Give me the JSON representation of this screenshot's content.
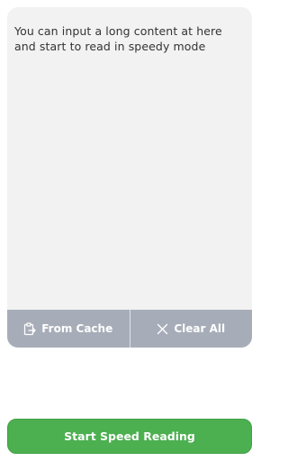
{
  "editor": {
    "placeholder": "You can input a long content at here and start to read in speedy mode"
  },
  "actions": {
    "from_cache_label": "From Cache",
    "clear_all_label": "Clear All"
  },
  "start_button": {
    "label": "Start Speed Reading"
  },
  "colors": {
    "editor_bg": "#f2f2f2",
    "action_bar_bg": "#a7adb8",
    "primary_green": "#4caf50"
  }
}
